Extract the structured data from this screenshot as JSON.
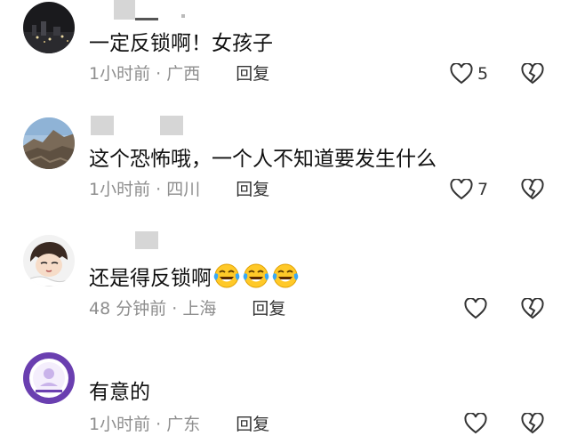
{
  "comments": [
    {
      "text": "一定反锁啊！女孩子",
      "time": "1小时前",
      "location": "广西",
      "reply_label": "回复",
      "like_count": "5",
      "avatar_icon": "night-city-avatar-icon"
    },
    {
      "text": "这个恐怖哦，一个人不知道要发生什么",
      "time": "1小时前",
      "location": "四川",
      "reply_label": "回复",
      "like_count": "7",
      "avatar_icon": "mountain-avatar-icon"
    },
    {
      "text": "还是得反锁啊",
      "emojis": [
        "laugh-cry-emoji",
        "laugh-cry-emoji",
        "laugh-cry-emoji"
      ],
      "time": "48 分钟前",
      "location": "上海",
      "reply_label": "回复",
      "like_count": "",
      "avatar_icon": "anime-character-avatar-icon"
    },
    {
      "text": "有意的",
      "time": "1小时前",
      "location": "广东",
      "reply_label": "回复",
      "like_count": "",
      "avatar_icon": "purple-circle-avatar-icon"
    }
  ],
  "separator": "·",
  "colors": {
    "text": "#111111",
    "meta": "#8e8e8e",
    "icon": "#333333"
  }
}
